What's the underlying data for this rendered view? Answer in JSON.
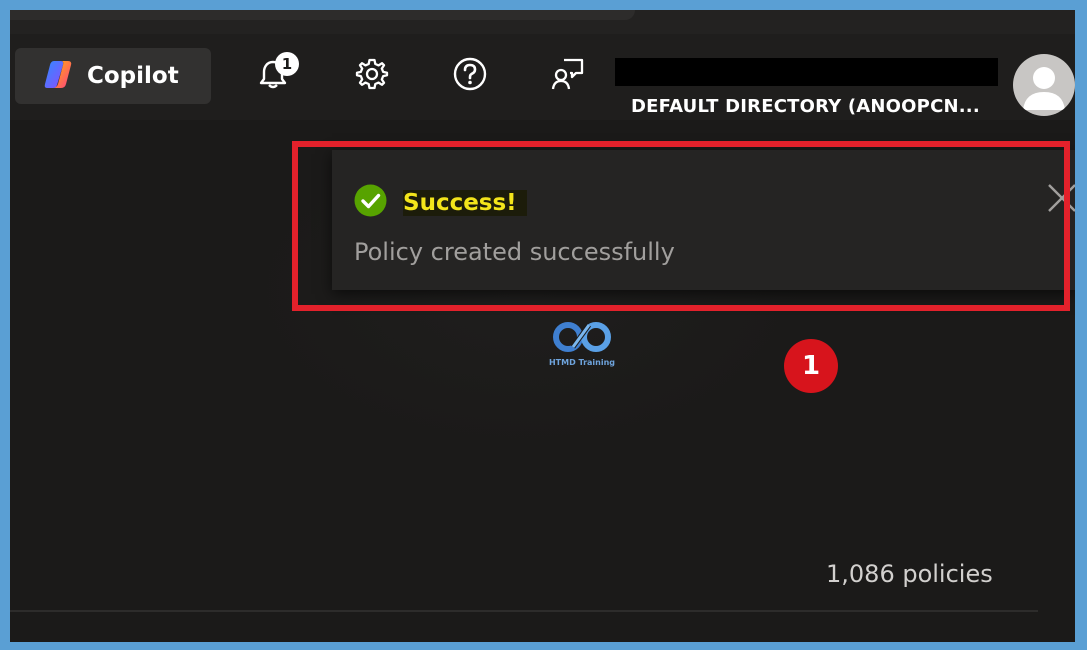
{
  "header": {
    "copilot_label": "Copilot",
    "notification_count": "1",
    "directory": "DEFAULT DIRECTORY (ANOOPCN..."
  },
  "icons": {
    "copilot": "copilot-icon",
    "notifications": "bell-icon",
    "settings": "gear-icon",
    "help": "question-icon",
    "feedback": "feedback-icon",
    "avatar": "user-avatar-icon",
    "success": "check-circle-icon",
    "close": "close-icon"
  },
  "toast": {
    "title": "Success!",
    "message": "Policy created successfully"
  },
  "annotation": {
    "step_number": "1"
  },
  "watermark": {
    "caption": "HTMD Training"
  },
  "content": {
    "policy_count": "1,086 policies"
  },
  "colors": {
    "background": "#1b1a19",
    "toast_background": "#252423",
    "success_green": "#57a300",
    "title_yellow": "#f3e51b",
    "highlight_red": "#e3212b",
    "frame_blue": "#5a9fd4"
  }
}
